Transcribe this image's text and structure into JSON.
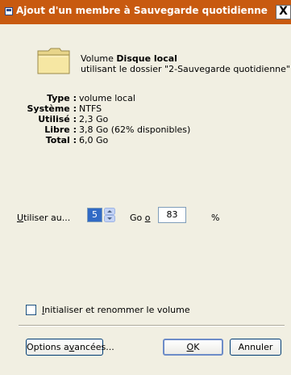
{
  "window": {
    "title": "Ajout d'un membre à Sauvegarde quotidienne",
    "close_label": "X"
  },
  "volume": {
    "prefix": "Volume",
    "name": "Disque local",
    "folder_line": "utilisant le dossier \"2-Sauvegarde quotidienne\"",
    "icon": "folder-icon"
  },
  "properties": [
    {
      "label": "Type :",
      "value": "volume local"
    },
    {
      "label": "Système :",
      "value": "NTFS"
    },
    {
      "label": "Utilisé :",
      "value": "2,3 Go"
    },
    {
      "label": "Libre :",
      "value": "3,8 Go (62% disponibles)"
    },
    {
      "label": "Total :",
      "value": "6,0 Go"
    }
  ],
  "usage": {
    "label_mnemonic": "U",
    "label_rest": "tiliser au...",
    "size_value": "5",
    "unit_prefix": "Go ",
    "unit_mnemonic": "o",
    "percent_value": "83",
    "percent_sign": "%"
  },
  "checkbox": {
    "mnemonic": "I",
    "label_rest": "nitialiser et renommer le volume",
    "checked": false
  },
  "buttons": {
    "advanced_prefix": "Options a",
    "advanced_mnemonic": "v",
    "advanced_suffix": "ancées...",
    "ok_mnemonic": "O",
    "ok_rest": "K",
    "cancel": "Annuler"
  },
  "colors": {
    "titlebar": "#c85a10",
    "dialog_bg": "#f1efe2",
    "selection": "#316ac5"
  }
}
